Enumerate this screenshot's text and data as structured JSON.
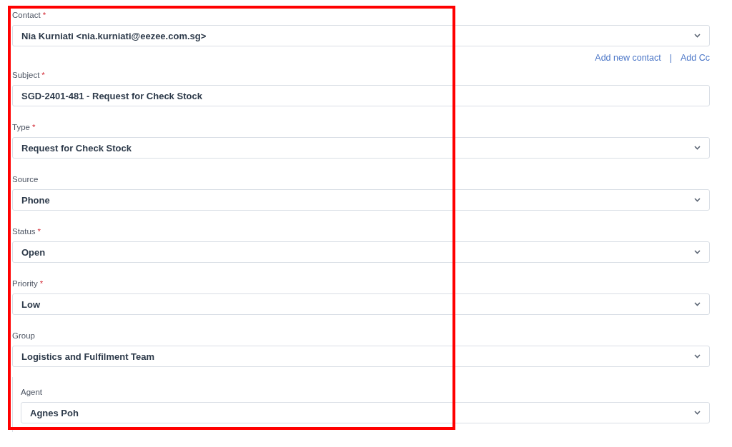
{
  "fields": [
    {
      "label": "Contact",
      "required": true,
      "kind": "select",
      "value": "Nia Kurniati <nia.kurniati@eezee.com.sg>",
      "indented": false
    },
    {
      "label": "Subject",
      "required": true,
      "kind": "text",
      "value": "SGD-2401-481 - Request for Check Stock",
      "indented": false
    },
    {
      "label": "Type",
      "required": true,
      "kind": "select",
      "value": "Request for Check Stock",
      "indented": false
    },
    {
      "label": "Source",
      "required": false,
      "kind": "select",
      "value": "Phone",
      "indented": false
    },
    {
      "label": "Status",
      "required": true,
      "kind": "select",
      "value": "Open",
      "indented": false
    },
    {
      "label": "Priority",
      "required": true,
      "kind": "select",
      "value": "Low",
      "indented": false
    },
    {
      "label": "Group",
      "required": false,
      "kind": "select",
      "value": "Logistics and Fulfilment Team",
      "indented": false
    },
    {
      "label": "Agent",
      "required": false,
      "kind": "select",
      "value": "Agnes Poh",
      "indented": true
    }
  ],
  "contact_links": [
    "Add new contact",
    "|",
    "Add Cc"
  ],
  "required_mark": "*",
  "highlight": true
}
